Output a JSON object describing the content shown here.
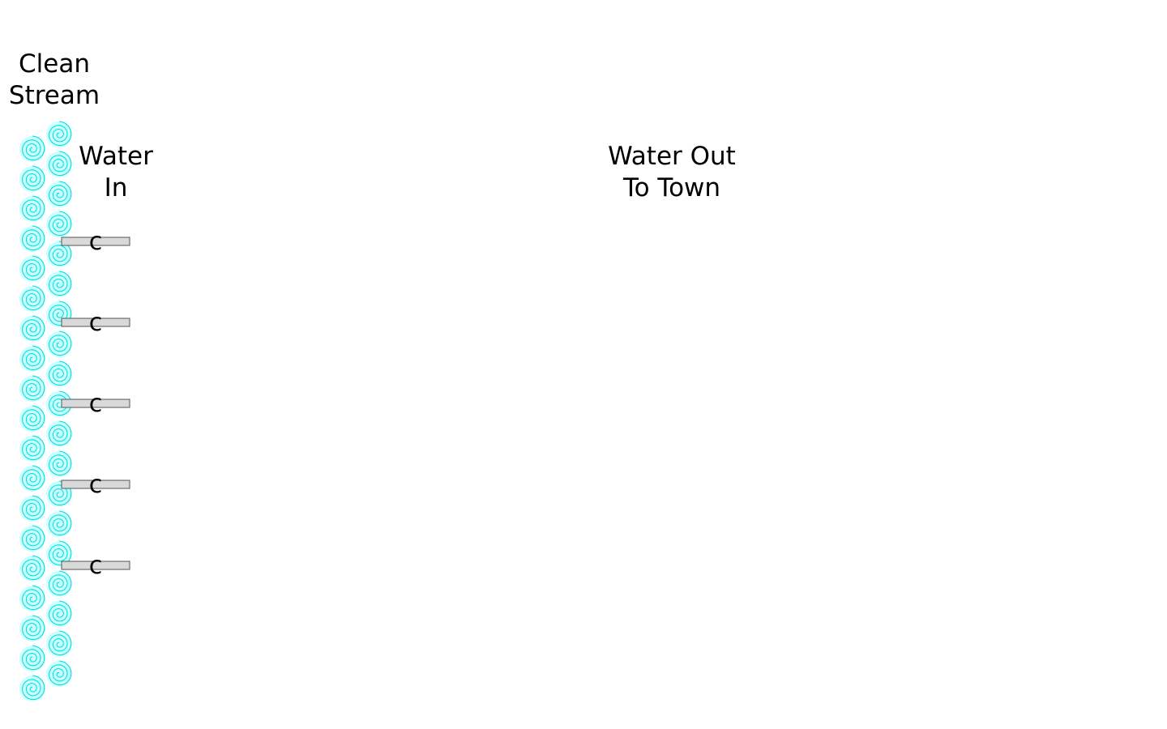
{
  "labels": {
    "stream": [
      "Clean",
      "Stream"
    ],
    "water_in": [
      "Water",
      "In"
    ],
    "water_out": [
      "Water Out",
      "To Town"
    ]
  },
  "pipe_symbol": "c",
  "pipe_count": 5,
  "colors": {
    "stream_spiral": "#00e0e0",
    "stream_fill": "#ccffff",
    "pipe_fill": "#d9d9d9",
    "pipe_stroke": "#555555",
    "text": "#000000",
    "background": "#ffffff"
  }
}
